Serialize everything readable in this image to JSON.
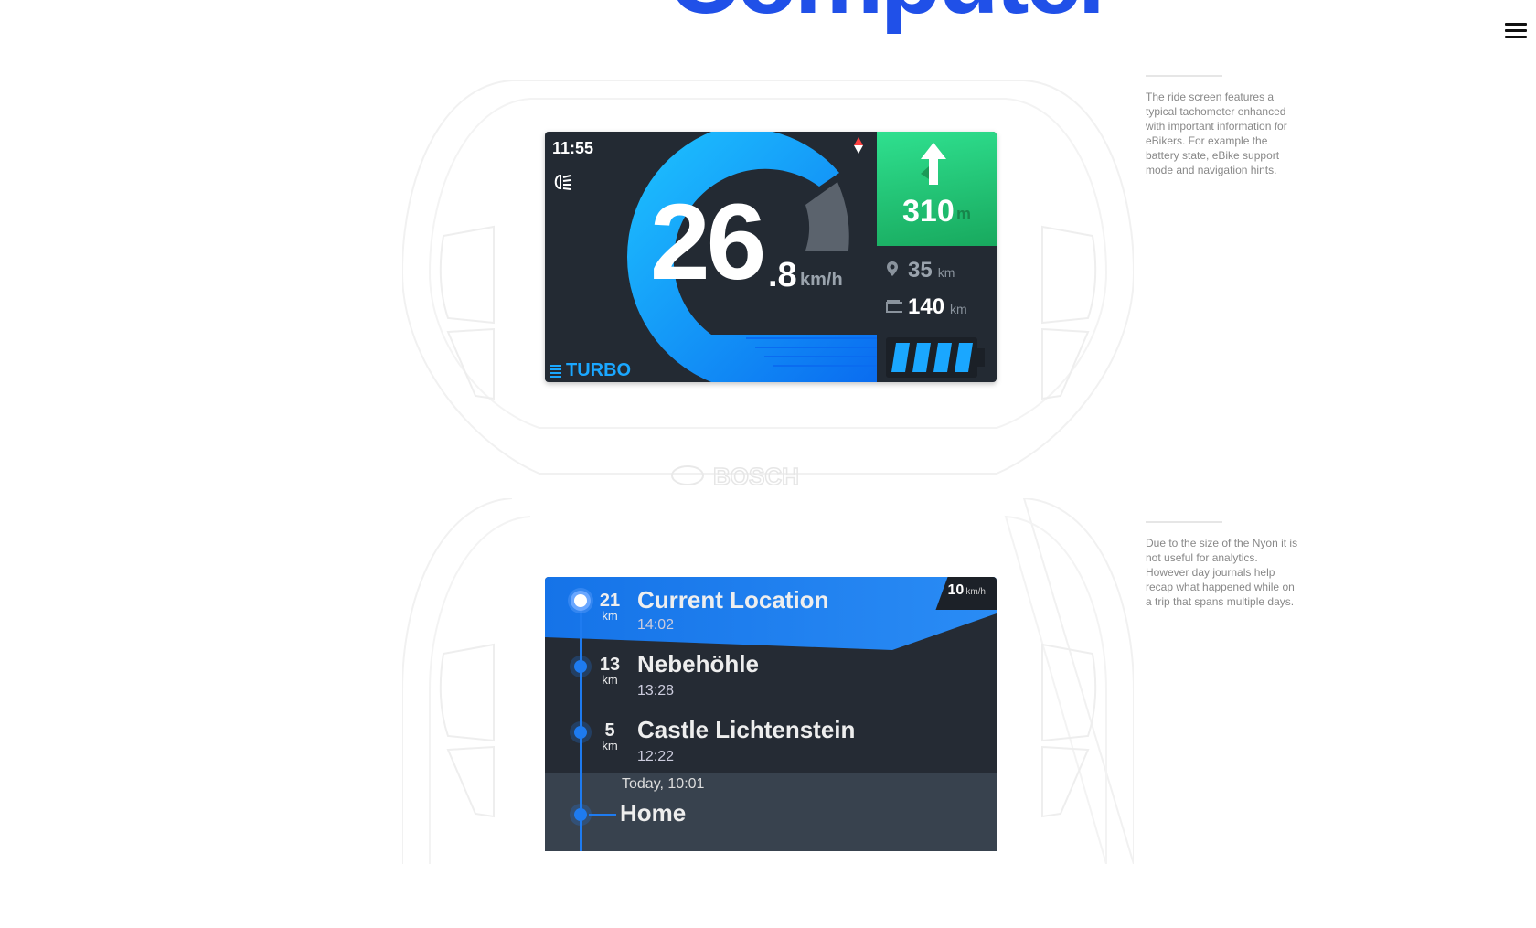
{
  "header": {
    "title": "Computer",
    "menu_icon": "hamburger-menu-icon"
  },
  "ride_screen": {
    "time": "11:55",
    "speed_int": "26",
    "speed_dec": ".8",
    "speed_unit": "km/h",
    "mode": "TURBO",
    "nav_distance": "310",
    "nav_unit": "m",
    "range_value": "35",
    "range_unit": "km",
    "odo_value": "140",
    "odo_unit": "km",
    "battery_bars": 4,
    "brand": "BOSCH",
    "colors": {
      "accent_blue": "#1aa7ff",
      "nav_green": "#2fe08f",
      "screen_bg": "#232a33"
    }
  },
  "ride_description": "The ride screen features a typical tachometer enhanced with important information for eBikers. For example the battery state, eBike support mode and navigation hints.",
  "journal_screen": {
    "speed_badge": "10",
    "speed_badge_unit": "km/h",
    "entries": [
      {
        "km": "21",
        "unit": "km",
        "place": "Current Location",
        "time": "14:02"
      },
      {
        "km": "13",
        "unit": "km",
        "place": "Nebehöhle",
        "time": "13:28"
      },
      {
        "km": "5",
        "unit": "km",
        "place": "Castle Lichtenstein",
        "time": "12:22"
      }
    ],
    "today_label": "Today, 10:01",
    "home_label": "Home"
  },
  "journal_description": "Due to the size of the Nyon it is not useful for analytics. However day journals help recap what happened while on a trip that spans multiple days."
}
